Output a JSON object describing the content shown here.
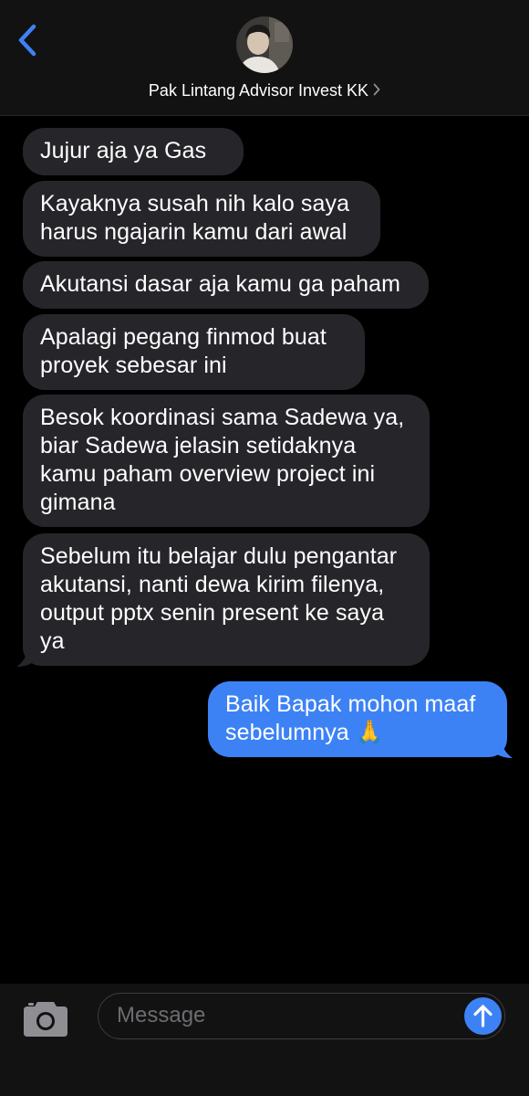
{
  "header": {
    "contact_name": "Pak Lintang Advisor Invest KK",
    "back_icon": "chevron-left-icon",
    "name_chevron_icon": "chevron-right-icon"
  },
  "messages": [
    {
      "direction": "incoming",
      "text": "Jujur aja ya Gas"
    },
    {
      "direction": "incoming",
      "text": "Kayaknya susah nih kalo saya harus ngajarin kamu dari awal"
    },
    {
      "direction": "incoming",
      "text": "Akutansi dasar aja kamu ga paham"
    },
    {
      "direction": "incoming",
      "text": "Apalagi pegang finmod buat proyek sebesar ini"
    },
    {
      "direction": "incoming",
      "text": "Besok koordinasi sama Sadewa ya, biar Sadewa jelasin setidaknya kamu paham overview project ini gimana"
    },
    {
      "direction": "incoming",
      "text": "Sebelum itu belajar dulu pengantar akutansi, nanti dewa kirim filenya, output pptx senin present ke saya ya"
    },
    {
      "direction": "outgoing",
      "text": "Baik Bapak mohon maaf sebelumnya 🙏"
    }
  ],
  "input_bar": {
    "placeholder": "Message",
    "camera_icon": "camera-icon",
    "send_icon": "arrow-up-icon"
  },
  "colors": {
    "accent": "#3d82f5",
    "incoming_bubble": "#26252a",
    "background": "#000000",
    "bar_background": "#121212"
  }
}
